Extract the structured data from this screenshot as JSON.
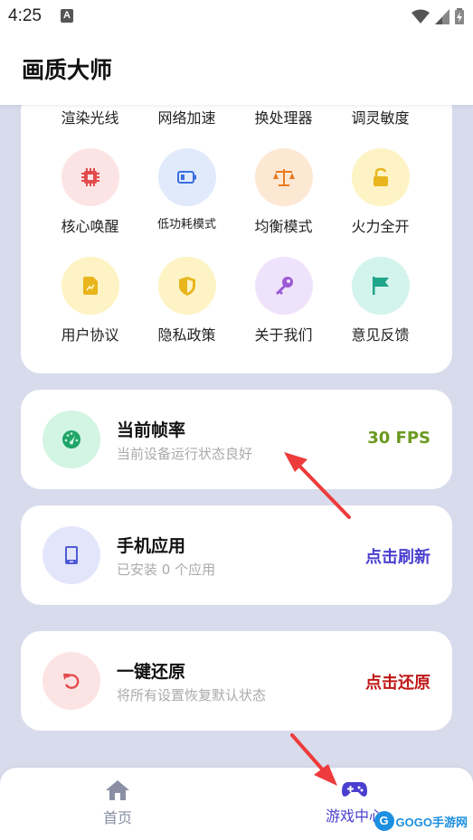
{
  "status_bar": {
    "time": "4:25",
    "a_icon": "A"
  },
  "app_bar": {
    "title": "画质大师"
  },
  "grid": {
    "row0": [
      {
        "label": "渲染光线"
      },
      {
        "label": "网络加速"
      },
      {
        "label": "换处理器"
      },
      {
        "label": "调灵敏度"
      }
    ],
    "row1": [
      {
        "label": "核心唤醒",
        "icon": "cpu-icon",
        "color": "#e24c4c",
        "bg": "#fde4e4"
      },
      {
        "label": "低功耗模式",
        "icon": "battery-icon",
        "color": "#3b6fe0",
        "bg": "#e1eafb"
      },
      {
        "label": "均衡模式",
        "icon": "scale-icon",
        "color": "#e87b22",
        "bg": "#fde8d4"
      },
      {
        "label": "火力全开",
        "icon": "unlock-icon",
        "color": "#e8b51c",
        "bg": "#fdf3c4"
      }
    ],
    "row2": [
      {
        "label": "用户协议",
        "icon": "document-icon",
        "color": "#e8b51c",
        "bg": "#fdf3c4"
      },
      {
        "label": "隐私政策",
        "icon": "shield-icon",
        "color": "#e8b51c",
        "bg": "#fdf3c4"
      },
      {
        "label": "关于我们",
        "icon": "key-icon",
        "color": "#9b59d6",
        "bg": "#efe2fb"
      },
      {
        "label": "意见反馈",
        "icon": "flag-icon",
        "color": "#1fa58a",
        "bg": "#d3f4ec"
      }
    ]
  },
  "cards": {
    "fps": {
      "title": "当前帧率",
      "subtitle": "当前设备运行状态良好",
      "action": "30 FPS",
      "action_color": "#6a9a1f",
      "icon": "speedometer-icon",
      "icon_color": "#1fa567",
      "icon_bg": "#d3f5e3"
    },
    "apps": {
      "title": "手机应用",
      "subtitle": "已安装 0 个应用",
      "action": "点击刷新",
      "action_color": "#4a3fd0",
      "icon": "phone-icon",
      "icon_color": "#4f5bd5",
      "icon_bg": "#e3e5fb"
    },
    "reset": {
      "title": "一键还原",
      "subtitle": "将所有设置恢复默认状态",
      "action": "点击还原",
      "action_color": "#c01818",
      "icon": "undo-icon",
      "icon_color": "#e24c4c",
      "icon_bg": "#fde4e4"
    }
  },
  "bottom_nav": {
    "home": {
      "label": "首页",
      "icon": "home-icon",
      "color": "#8a8fa3"
    },
    "game": {
      "label": "游戏中心",
      "icon": "gamepad-icon",
      "color": "#4a3fd0"
    }
  },
  "watermark": {
    "circle": "G",
    "text": "GOGO手游网"
  }
}
